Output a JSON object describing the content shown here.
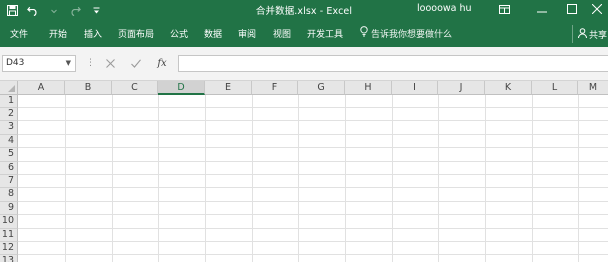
{
  "titlebar": {
    "title": "合并数据.xlsx  -  Excel",
    "username": "loooowa hu",
    "icons": [
      "save-icon",
      "undo-icon",
      "redo-icon",
      "customize-qat-icon",
      "ribbon-display-icon",
      "minimize-icon",
      "maximize-icon",
      "close-icon"
    ]
  },
  "ribbon": {
    "tabs": [
      "文件",
      "开始",
      "插入",
      "页面布局",
      "公式",
      "数据",
      "审阅",
      "视图",
      "开发工具"
    ],
    "tell_me": "告诉我你想要做什么",
    "share": "共享"
  },
  "formula_bar": {
    "name_box": "D43",
    "separator": "⋮",
    "cancel_symbol": "✕",
    "enter_symbol": "✓",
    "fx_symbol": "fx",
    "formula": ""
  },
  "sheet": {
    "columns": [
      "A",
      "B",
      "C",
      "D",
      "E",
      "F",
      "G",
      "H",
      "I",
      "J",
      "K",
      "L",
      "M"
    ],
    "selected_column": "D",
    "rows": [
      "1",
      "2",
      "3",
      "4",
      "5",
      "6",
      "7",
      "8",
      "9",
      "10",
      "11",
      "12",
      "13"
    ]
  },
  "colors": {
    "excel_green": "#217346",
    "header_bg": "#e6e6e6",
    "grid_line": "#e1e1e1"
  }
}
